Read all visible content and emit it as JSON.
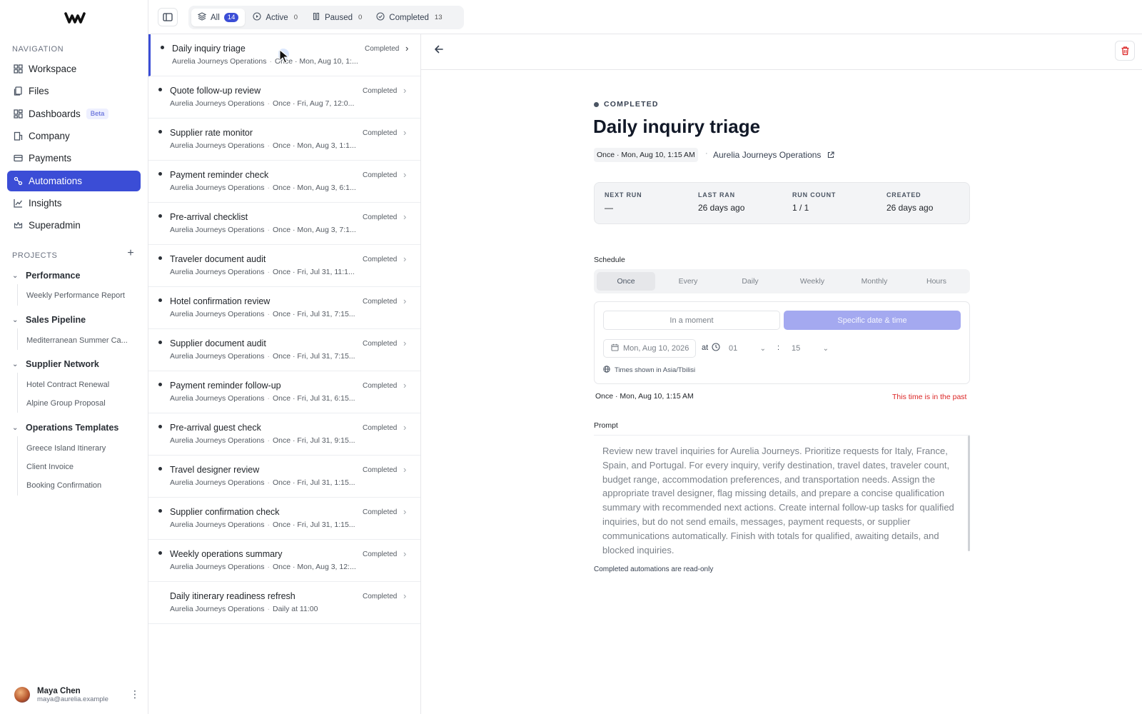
{
  "sidebar": {
    "navigation_label": "NAVIGATION",
    "nav_items": [
      {
        "label": "Workspace",
        "icon": "grid-icon"
      },
      {
        "label": "Files",
        "icon": "files-icon"
      },
      {
        "label": "Dashboards",
        "icon": "dashboard-icon",
        "badge": "Beta"
      },
      {
        "label": "Company",
        "icon": "building-icon"
      },
      {
        "label": "Payments",
        "icon": "card-icon"
      },
      {
        "label": "Automations",
        "icon": "automation-icon",
        "active": true
      },
      {
        "label": "Insights",
        "icon": "chart-icon"
      },
      {
        "label": "Superadmin",
        "icon": "crown-icon"
      }
    ],
    "projects_label": "PROJECTS",
    "project_groups": [
      {
        "name": "Performance",
        "items": [
          "Weekly Performance Report"
        ]
      },
      {
        "name": "Sales Pipeline",
        "items": [
          "Mediterranean Summer Ca..."
        ]
      },
      {
        "name": "Supplier Network",
        "items": [
          "Hotel Contract Renewal",
          "Alpine Group Proposal"
        ]
      },
      {
        "name": "Operations Templates",
        "items": [
          "Greece Island Itinerary",
          "Client Invoice",
          "Booking Confirmation"
        ]
      }
    ],
    "user": {
      "name": "Maya Chen",
      "email": "maya@aurelia.example"
    }
  },
  "filters": [
    {
      "label": "All",
      "count": "14",
      "active": true
    },
    {
      "label": "Active",
      "count": "0"
    },
    {
      "label": "Paused",
      "count": "0"
    },
    {
      "label": "Completed",
      "count": "13"
    }
  ],
  "automations": [
    {
      "title": "Daily inquiry triage",
      "org": "Aurelia Journeys Operations",
      "schedule": "Once · Mon, Aug 10, 1:...",
      "status": "Completed",
      "selected": true
    },
    {
      "title": "Quote follow-up review",
      "org": "Aurelia Journeys Operations",
      "schedule": "Once · Fri, Aug 7, 12:0...",
      "status": "Completed"
    },
    {
      "title": "Supplier rate monitor",
      "org": "Aurelia Journeys Operations",
      "schedule": "Once · Mon, Aug 3, 1:1...",
      "status": "Completed"
    },
    {
      "title": "Payment reminder check",
      "org": "Aurelia Journeys Operations",
      "schedule": "Once · Mon, Aug 3, 6:1...",
      "status": "Completed"
    },
    {
      "title": "Pre-arrival checklist",
      "org": "Aurelia Journeys Operations",
      "schedule": "Once · Mon, Aug 3, 7:1...",
      "status": "Completed"
    },
    {
      "title": "Traveler document audit",
      "org": "Aurelia Journeys Operations",
      "schedule": "Once · Fri, Jul 31, 11:1...",
      "status": "Completed"
    },
    {
      "title": "Hotel confirmation review",
      "org": "Aurelia Journeys Operations",
      "schedule": "Once · Fri, Jul 31, 7:15...",
      "status": "Completed"
    },
    {
      "title": "Supplier document audit",
      "org": "Aurelia Journeys Operations",
      "schedule": "Once · Fri, Jul 31, 7:15...",
      "status": "Completed"
    },
    {
      "title": "Payment reminder follow-up",
      "org": "Aurelia Journeys Operations",
      "schedule": "Once · Fri, Jul 31, 6:15...",
      "status": "Completed"
    },
    {
      "title": "Pre-arrival guest check",
      "org": "Aurelia Journeys Operations",
      "schedule": "Once · Fri, Jul 31, 9:15...",
      "status": "Completed"
    },
    {
      "title": "Travel designer review",
      "org": "Aurelia Journeys Operations",
      "schedule": "Once · Fri, Jul 31, 1:15...",
      "status": "Completed"
    },
    {
      "title": "Supplier confirmation check",
      "org": "Aurelia Journeys Operations",
      "schedule": "Once · Fri, Jul 31, 1:15...",
      "status": "Completed"
    },
    {
      "title": "Weekly operations summary",
      "org": "Aurelia Journeys Operations",
      "schedule": "Once · Mon, Aug 3, 12:...",
      "status": "Completed"
    },
    {
      "title": "Daily itinerary readiness refresh",
      "org": "Aurelia Journeys Operations",
      "schedule": "Daily at 11:00",
      "status": "Completed"
    }
  ],
  "detail": {
    "status": "COMPLETED",
    "title": "Daily inquiry triage",
    "schedule_chip": "Once · Mon, Aug 10, 1:15 AM",
    "org_link": "Aurelia Journeys Operations",
    "stats": [
      {
        "label": "NEXT RUN",
        "value": "—"
      },
      {
        "label": "LAST RAN",
        "value": "26 days ago"
      },
      {
        "label": "RUN COUNT",
        "value": "1 / 1"
      },
      {
        "label": "CREATED",
        "value": "26 days ago"
      }
    ],
    "schedule_label": "Schedule",
    "schedule_tabs": [
      "Once",
      "Every",
      "Daily",
      "Weekly",
      "Monthly",
      "Hours"
    ],
    "active_schedule_tab": "Once",
    "mode_moment": "In a moment",
    "mode_specific": "Specific date & time",
    "date_value": "Mon, Aug 10, 2026",
    "at_label": "at",
    "hour_value": "01",
    "minute_value": "15",
    "timezone_note": "Times shown in Asia/Tbilisi",
    "schedule_summary": "Once · Mon, Aug 10, 1:15 AM",
    "past_warning": "This time is in the past",
    "prompt_label": "Prompt",
    "prompt_text": "Review new travel inquiries for Aurelia Journeys. Prioritize requests for Italy, France, Spain, and Portugal. For every inquiry, verify destination, travel dates, traveler count, budget range, accommodation preferences, and transportation needs. Assign the appropriate travel designer, flag missing details, and prepare a concise qualification summary with recommended next actions. Create internal follow-up tasks for qualified inquiries, but do not send emails, messages, payment requests, or supplier communications automatically. Finish with totals for qualified, awaiting details, and blocked inquiries.",
    "readonly_note": "Completed automations are read-only"
  },
  "colors": {
    "accent": "#3b4dd6",
    "danger": "#dc2626",
    "specific_btn": "#a4a9f0"
  }
}
